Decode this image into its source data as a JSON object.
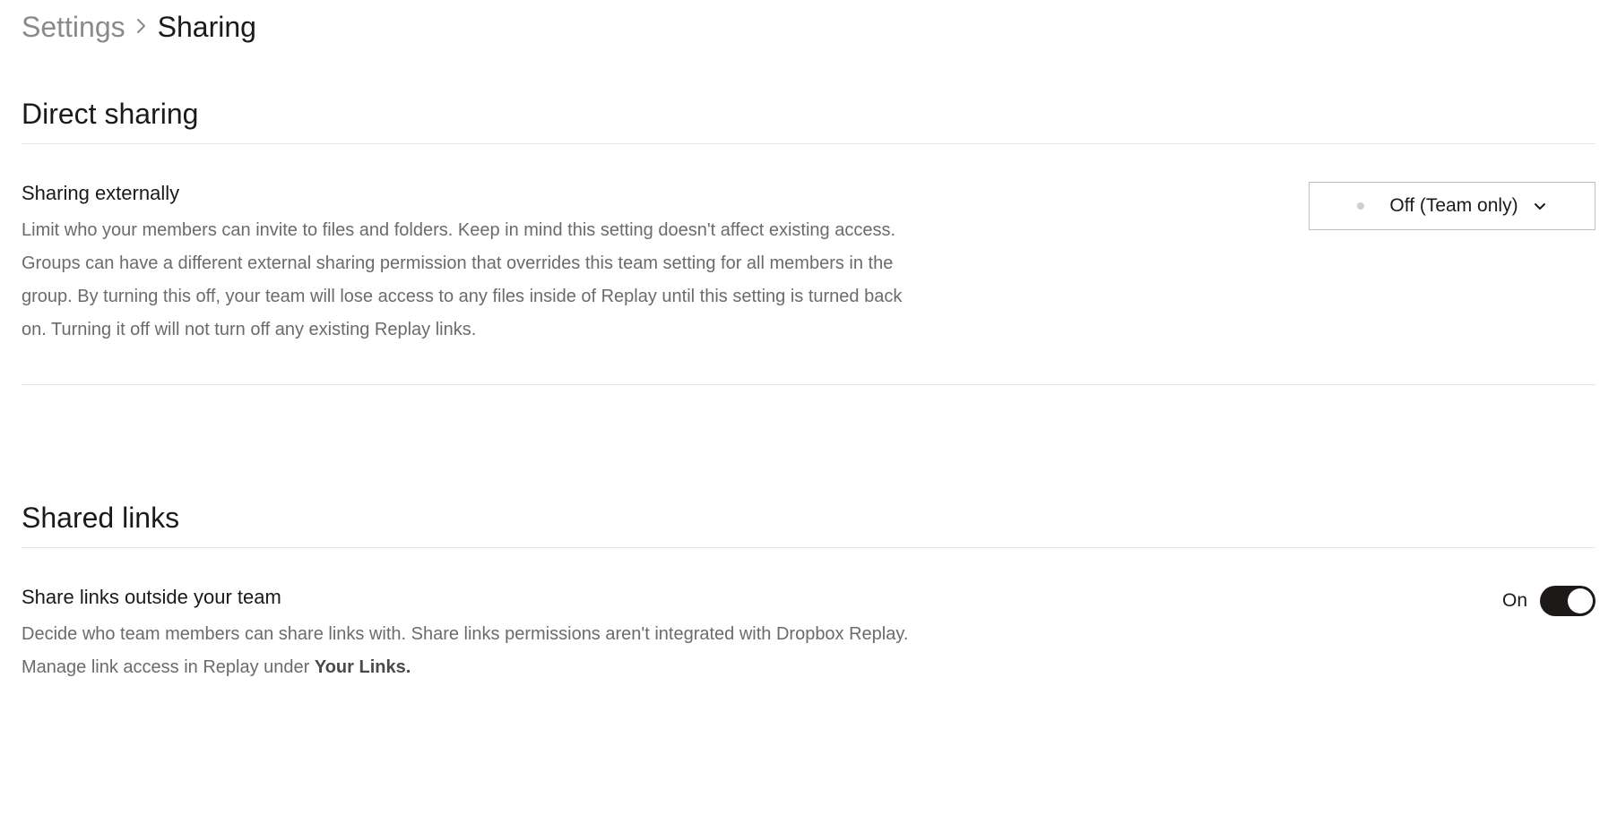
{
  "breadcrumb": {
    "parent": "Settings",
    "current": "Sharing"
  },
  "sections": {
    "direct_sharing": {
      "title": "Direct sharing",
      "setting": {
        "label": "Sharing externally",
        "description": "Limit who your members can invite to files and folders. Keep in mind this setting doesn't affect existing access. Groups can have a different external sharing permission that overrides this team setting for all members in the group. By turning this off, your team will lose access to any files inside of Replay until this setting is turned back on. Turning it off will not turn off any existing Replay links.",
        "dropdown_value": "Off (Team only)"
      }
    },
    "shared_links": {
      "title": "Shared links",
      "setting": {
        "label": "Share links outside your team",
        "description_part1": "Decide who team members can share links with. Share links permissions aren't integrated with Dropbox Replay. Manage link access in Replay under ",
        "description_bold": "Your Links.",
        "toggle_label": "On",
        "toggle_state": "on"
      }
    }
  }
}
